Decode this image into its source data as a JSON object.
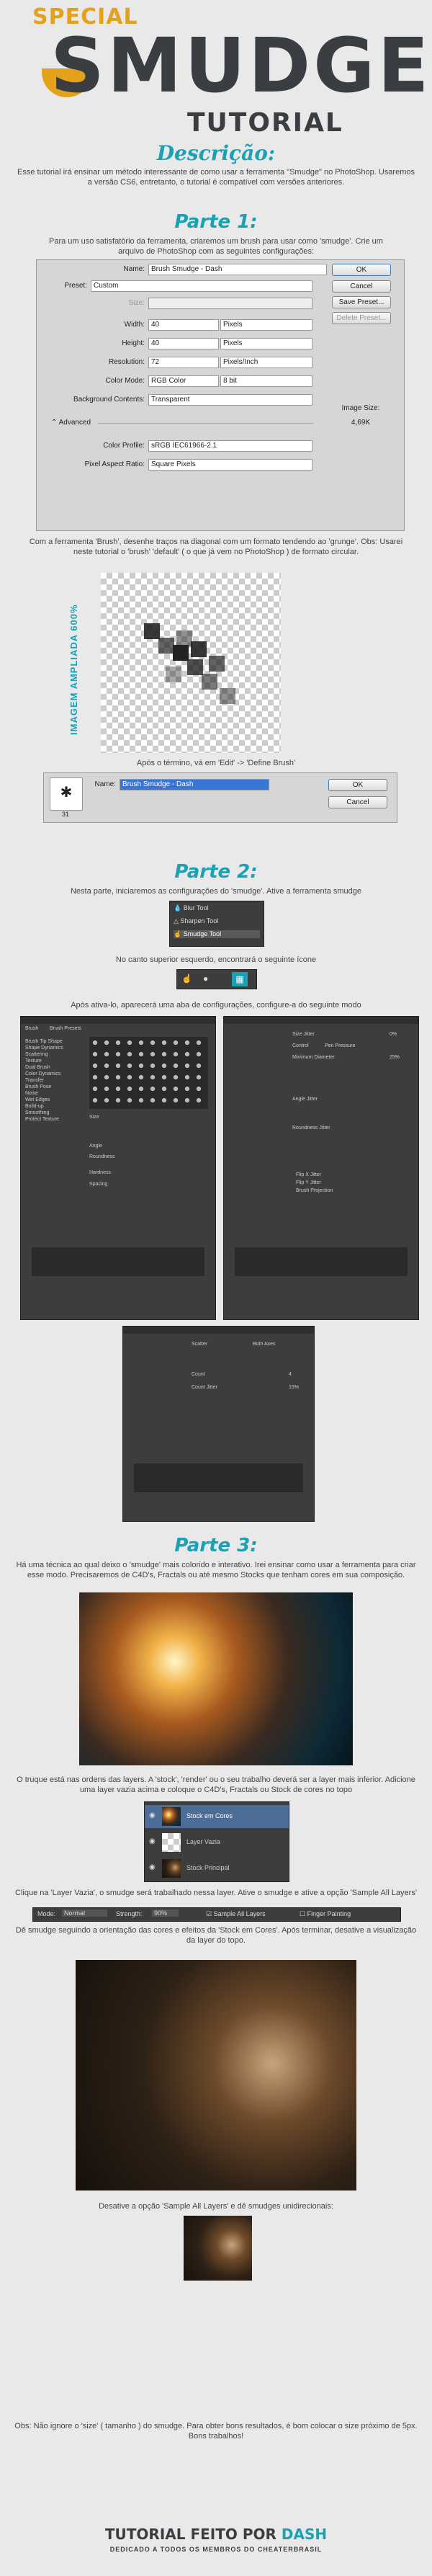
{
  "header": {
    "special": "SPECIAL",
    "title": "SMUDGE",
    "subtitle": "TUTORIAL"
  },
  "descricao": {
    "heading": "Descrição:",
    "text": "Esse tutorial irá ensinar um método interessante de como usar a ferramenta \"Smudge\" no PhotoShop. Usaremos a versão CS6, entretanto, o tutorial é compatível com versões anteriores."
  },
  "parte1": {
    "heading": "Parte 1:",
    "intro": "Para um uso satisfatório da ferramenta, criaremos um brush para usar como 'smudge'. Crie um arquivo de PhotoShop com as seguintes configurações:",
    "dialog": {
      "name_label": "Name:",
      "name_value": "Brush Smudge - Dash",
      "preset_label": "Preset:",
      "preset_value": "Custom",
      "size_label": "Size:",
      "width_label": "Width:",
      "width_value": "40",
      "width_unit": "Pixels",
      "height_label": "Height:",
      "height_value": "40",
      "height_unit": "Pixels",
      "resolution_label": "Resolution:",
      "resolution_value": "72",
      "resolution_unit": "Pixels/Inch",
      "colormode_label": "Color Mode:",
      "colormode_value": "RGB Color",
      "colormode_bits": "8 bit",
      "bg_label": "Background Contents:",
      "bg_value": "Transparent",
      "advanced": "Advanced",
      "profile_label": "Color Profile:",
      "profile_value": "sRGB IEC61966-2.1",
      "aspect_label": "Pixel Aspect Ratio:",
      "aspect_value": "Square Pixels",
      "ok": "OK",
      "cancel": "Cancel",
      "save_preset": "Save Preset...",
      "delete_preset": "Delete Preset...",
      "image_size_label": "Image Size:",
      "image_size_value": "4,69K"
    },
    "text2": "Com a ferramenta 'Brush', desenhe traços na diagonal com um formato tendendo ao 'grunge'. Obs: Usarei neste tutorial o 'brush' 'default' ( o que já vem no PhotoShop ) de formato circular.",
    "zoom_label": "IMAGEM AMPLIADA 600%",
    "text3": "Após o término, vá em 'Edit' -> 'Define Brush'",
    "brush_dialog": {
      "name_label": "Name:",
      "name_value": "Brush Smudge - Dash",
      "size": "31",
      "ok": "OK",
      "cancel": "Cancel"
    }
  },
  "parte2": {
    "heading": "Parte 2:",
    "text1": "Nesta parte, iniciaremos as configurações do 'smudge'. Ative a ferramenta smudge",
    "tools": [
      "Blur Tool",
      "Sharpen Tool",
      "Smudge Tool"
    ],
    "text2": "No canto superior esquerdo, encontrará o seguinte ícone",
    "text3": "Após ativa-lo, aparecerá uma aba de configurações, configure-a do seguinte modo",
    "panel_tabs": [
      "Brush",
      "Brush Presets"
    ],
    "panel_items": [
      "Brush Tip Shape",
      "Shape Dynamics",
      "Scattering",
      "Texture",
      "Dual Brush",
      "Color Dynamics",
      "Transfer",
      "Brush Pose",
      "Noise",
      "Wet Edges",
      "Build-up",
      "Smoothing",
      "Protect Texture"
    ],
    "panel_fields": [
      "Size",
      "Angle",
      "Roundness",
      "Hardness",
      "Spacing",
      "Size Jitter",
      "Control",
      "Minimum Diameter",
      "Angle Jitter",
      "Roundness Jitter",
      "Flip X Jitter",
      "Flip Y Jitter",
      "Brush Projection",
      "Scatter",
      "Count",
      "Count Jitter"
    ],
    "panel_values": [
      "25%",
      "Pen Pressure",
      "Off",
      "Both Axes",
      "4",
      "15%",
      "23px",
      "0%"
    ]
  },
  "parte3": {
    "heading": "Parte 3:",
    "text1": "Há uma técnica ao qual deixo o 'smudge' mais colorido e interativo. Irei ensinar como usar a ferramenta para criar esse modo. Precisaremos de C4D's, Fractals ou até mesmo Stocks que tenham cores em sua composição.",
    "text2": "O truque está nas ordens das layers. A 'stock', 'render' ou o seu trabalho deverá ser a layer mais inferior. Adicione uma layer vazia acima e coloque o C4D's, Fractals ou Stock de cores no topo",
    "layers": [
      "Stock em Cores",
      "Layer Vazia",
      "Stock Principal"
    ],
    "text3": "Clique na 'Layer Vazia', o smudge será trabalhado nessa layer. Ative o smudge e ative a opção 'Sample All Layers'",
    "options_bar": {
      "mode_label": "Mode:",
      "mode_value": "Normal",
      "strength_label": "Strength:",
      "strength_value": "90%",
      "sample_all": "Sample All Layers",
      "finger": "Finger Painting"
    },
    "text4": "Dê smudge seguindo a orientação das cores e efeitos da 'Stock em Cores'. Após terminar, desative a visualização da layer do topo.",
    "text5": "Desative a opção 'Sample All Layers' e dê smudges unidirecionais:",
    "text6": "Obs: Não ignore o 'size' ( tamanho ) do smudge. Para obter bons resultados, é bom colocar o size próximo de 5px. Bons trabalhos!"
  },
  "footer": {
    "title_prefix": "TUTORIAL FEITO POR",
    "title_name": "DASH",
    "subtitle": "DEDICADO A TODOS OS MEMBROS DO CHEATERBRASIL"
  },
  "colors": {
    "accent": "#1aa1b3",
    "dark": "#3a3d42",
    "gold": "#e3a21a"
  }
}
